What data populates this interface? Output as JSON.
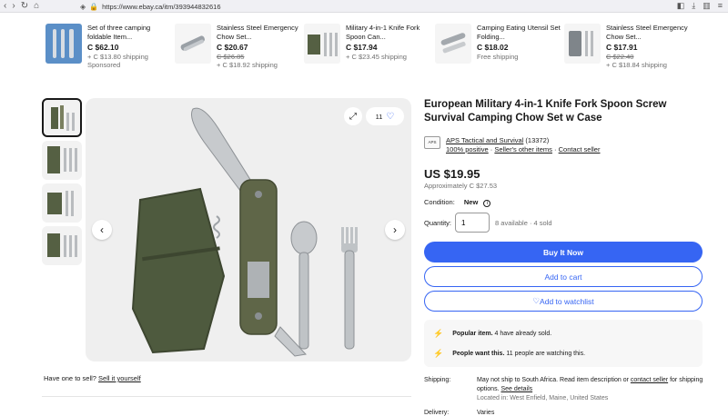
{
  "browser": {
    "url": "https://www.ebay.ca/itm/393944832616"
  },
  "carousel": [
    {
      "title": "Set of three camping foldable Item...",
      "price": "C $62.10",
      "old": "",
      "sub1": "+ C $13.80 shipping",
      "sub2": "Sponsored"
    },
    {
      "title": "Stainless Steel Emergency Chow Set...",
      "price": "C $20.67",
      "old": "C $26.85",
      "sub1": "+ C $18.92 shipping",
      "sub2": ""
    },
    {
      "title": "Military 4-in-1 Knife Fork Spoon Can...",
      "price": "C $17.94",
      "old": "",
      "sub1": "+ C $23.45 shipping",
      "sub2": ""
    },
    {
      "title": "Camping Eating Utensil Set Folding...",
      "price": "C $18.02",
      "old": "",
      "sub1": "Free shipping",
      "sub2": ""
    },
    {
      "title": "Stainless Steel Emergency Chow Set...",
      "price": "C $17.91",
      "old": "C $22.40",
      "sub1": "+ C $18.84 shipping",
      "sub2": ""
    }
  ],
  "gallery": {
    "watch_count": "11",
    "sell_prompt": "Have one to sell?",
    "sell_link": "Sell it yourself"
  },
  "item": {
    "title": "European Military 4-in-1 Knife Fork Spoon Screw Survival Camping Chow Set w Case",
    "seller_name": "APS Tactical and Survival",
    "seller_count": "(13372)",
    "seller_positive": "100% positive",
    "seller_other": "Seller's other items",
    "seller_contact": "Contact seller",
    "price": "US $19.95",
    "approx": "Approximately C $27.53",
    "condition_label": "Condition:",
    "condition_value": "New",
    "qty_label": "Quantity:",
    "qty_value": "1",
    "availability": "8 available · 4 sold",
    "buy_now": "Buy It Now",
    "add_cart": "Add to cart",
    "add_watch": "Add to watchlist",
    "promo1_bold": "Popular item.",
    "promo1_rest": "4 have already sold.",
    "promo2_bold": "People want this.",
    "promo2_rest": "11 people are watching this.",
    "shipping_label": "Shipping:",
    "shipping_text": "May not ship to South Africa. Read item description or",
    "shipping_contact": "contact seller",
    "shipping_text2": "for shipping options.",
    "shipping_details": "See details",
    "location": "Located in: West Enfield, Maine, United States",
    "delivery_label": "Delivery:",
    "delivery_value": "Varies"
  },
  "colors": {
    "accent": "#3665f3",
    "olive": "#556043"
  }
}
